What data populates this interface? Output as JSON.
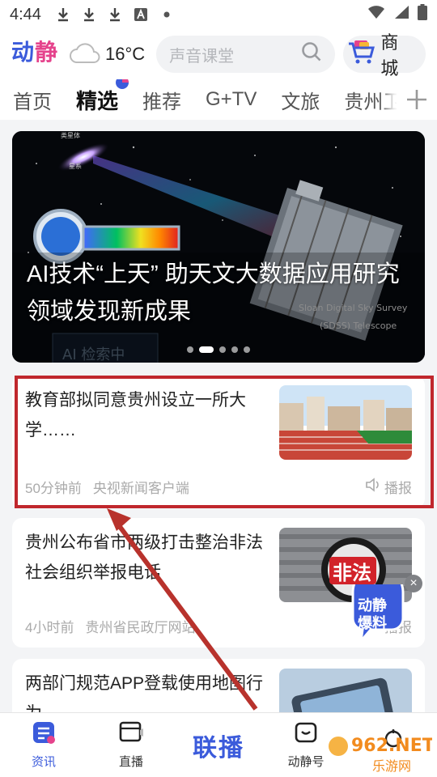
{
  "status_bar": {
    "time": "4:44",
    "icons": [
      "download-icon",
      "download-icon",
      "download-icon",
      "a-icon",
      "dot-icon"
    ],
    "right_icons": [
      "wifi-icon",
      "signal-icon",
      "battery-icon"
    ]
  },
  "header": {
    "logo": "动静",
    "temperature": "16°C",
    "search_placeholder": "声音课堂",
    "shop_label": "商城"
  },
  "tabs": [
    {
      "label": "首页",
      "active": false
    },
    {
      "label": "精选",
      "active": true
    },
    {
      "label": "推荐",
      "active": false
    },
    {
      "label": "G+TV",
      "active": false
    },
    {
      "label": "文旅",
      "active": false
    },
    {
      "label": "贵州卫",
      "active": false
    }
  ],
  "banner": {
    "headline": "AI技术“上天” 助天文大数据应用研究领域发现新成果",
    "image_texts": [
      "Sloan Digital Sky Survey",
      "(SDSS) Telescope",
      "AI 检索中",
      "类星体",
      "星系"
    ],
    "active_dot": 1,
    "dot_count": 5
  },
  "news": [
    {
      "title": "教育部拟同意贵州设立一所大学……",
      "time": "50分钟前",
      "source": "央视新闻客户端",
      "action": "播报"
    },
    {
      "title": "贵州公布省市两级打击整治非法社会组织举报电话",
      "time": "4小时前",
      "source": "贵州省民政厅网站",
      "action": "播报"
    },
    {
      "title": "两部门规范APP登载使用地图行为",
      "time": "",
      "source": "",
      "action": ""
    }
  ],
  "thumb_texts": {
    "illegal": "非法"
  },
  "floating_badge": {
    "line1": "动静",
    "line2": "爆料"
  },
  "bottom_nav": [
    {
      "label": "资讯",
      "icon": "news-icon",
      "active": true
    },
    {
      "label": "直播",
      "icon": "live-tv-icon",
      "active": false
    },
    {
      "label": "联播",
      "icon": "",
      "active": false
    },
    {
      "label": "动静号",
      "icon": "smile-box-icon",
      "active": false
    },
    {
      "label": "",
      "icon": "profile-icon",
      "active": false
    }
  ],
  "watermark": {
    "site": "962.NET",
    "sub": "乐游网"
  },
  "colors": {
    "brand_blue": "#3b5bdb",
    "brand_pink": "#e5438c",
    "highlight_red": "#c0272d"
  }
}
